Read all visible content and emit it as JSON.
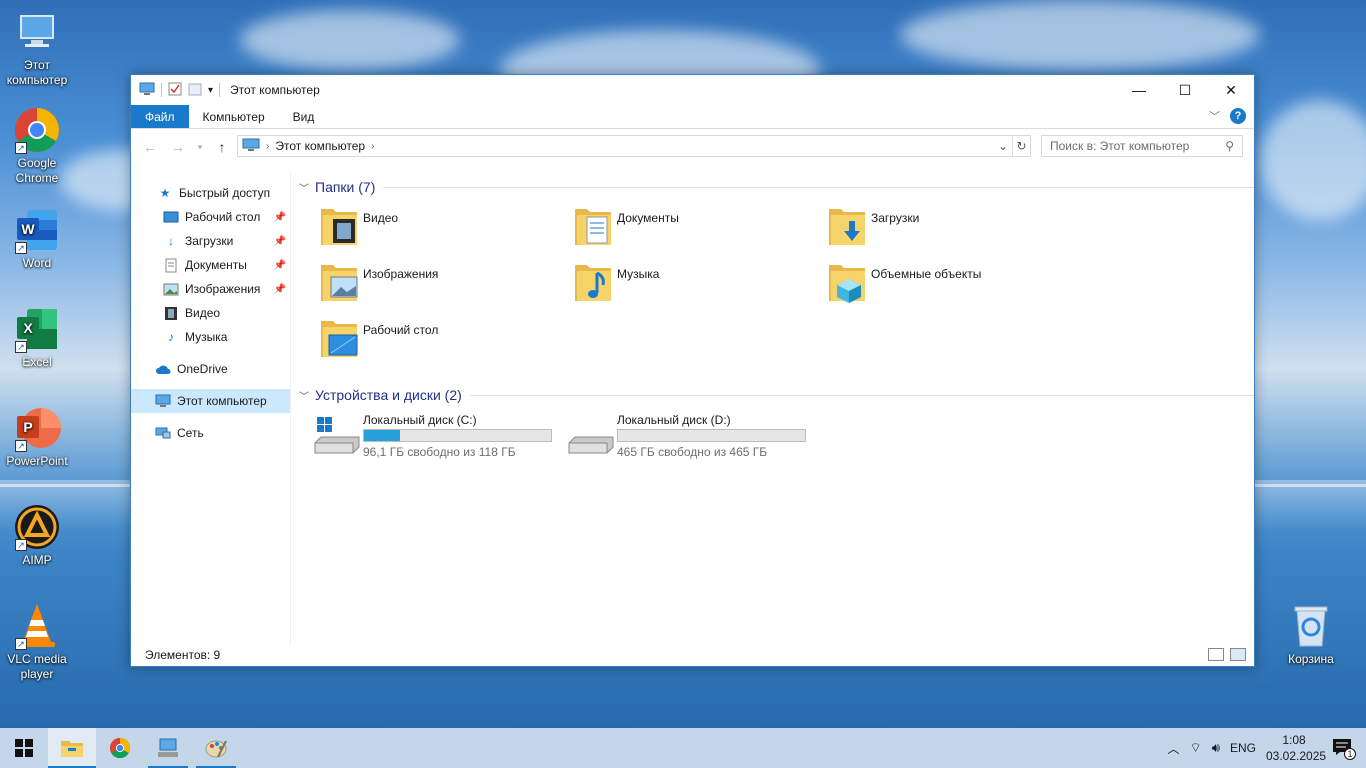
{
  "desktop": {
    "icons": [
      {
        "label": "Этот компьютер"
      },
      {
        "label": "Google Chrome"
      },
      {
        "label": "Word"
      },
      {
        "label": "Excel"
      },
      {
        "label": "PowerPoint"
      },
      {
        "label": "AIMP"
      },
      {
        "label": "VLC media player"
      },
      {
        "label": "Корзина"
      }
    ]
  },
  "window": {
    "title": "Этот компьютер",
    "ribbon_tabs": [
      "Файл",
      "Компьютер",
      "Вид"
    ],
    "address": "Этот компьютер",
    "search_placeholder": "Поиск в: Этот компьютер",
    "nav_pane": {
      "quick_access": "Быстрый доступ",
      "items": [
        "Рабочий стол",
        "Загрузки",
        "Документы",
        "Изображения",
        "Видео",
        "Музыка"
      ],
      "onedrive": "OneDrive",
      "this_pc": "Этот компьютер",
      "network": "Сеть"
    },
    "folders_group": "Папки (7)",
    "folders": [
      "Видео",
      "Документы",
      "Загрузки",
      "Изображения",
      "Музыка",
      "Объемные объекты",
      "Рабочий стол"
    ],
    "drives_group": "Устройства и диски (2)",
    "drives": [
      {
        "name": "Локальный диск (C:)",
        "free": "96,1 ГБ свободно из 118 ГБ",
        "used_fraction": 0.19
      },
      {
        "name": "Локальный диск (D:)",
        "free": "465 ГБ свободно из 465 ГБ",
        "used_fraction": 0.0
      }
    ],
    "status": "Элементов: 9"
  },
  "taskbar": {
    "lang": "ENG",
    "time": "1:08",
    "date": "03.02.2025",
    "notifications": "1"
  },
  "colors": {
    "accent": "#1979ca",
    "drive_fill": "#26a0da",
    "folder_yellow": "#f7d46a"
  }
}
